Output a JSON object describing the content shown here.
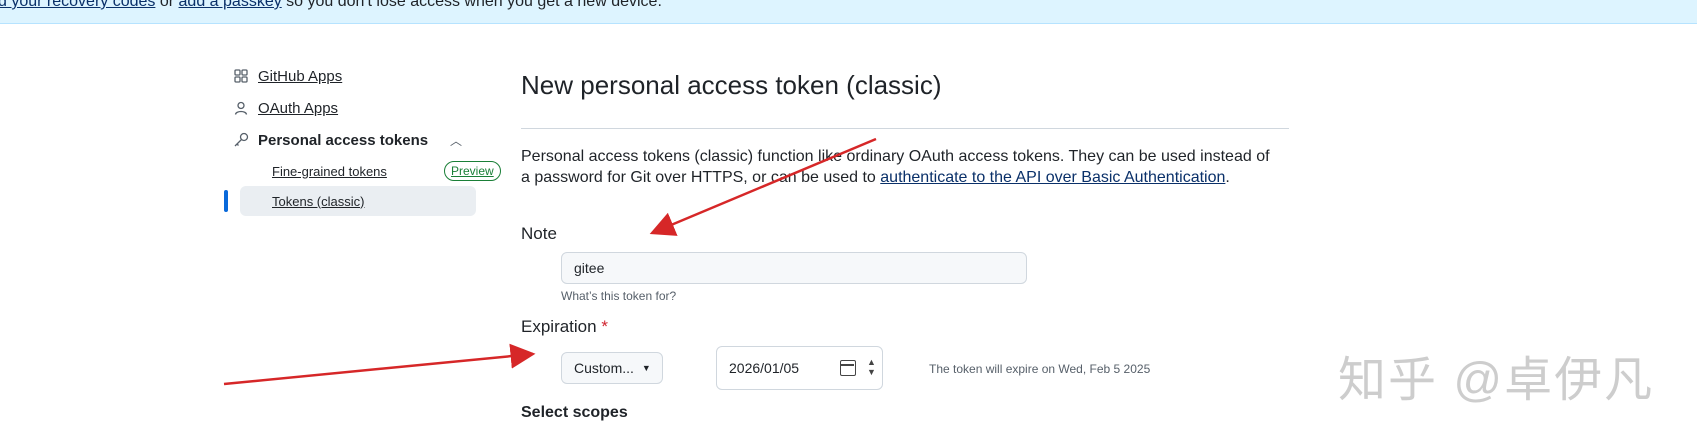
{
  "banner": {
    "link1": "d your recovery codes",
    "between": " or ",
    "link2": "add a passkey",
    "rest": " so you don't lose access when you get a new device."
  },
  "sidebar": {
    "items": [
      {
        "label": "GitHub Apps",
        "icon": "apps-icon"
      },
      {
        "label": "OAuth Apps",
        "icon": "person-icon"
      },
      {
        "label": "Personal access tokens",
        "icon": "key-icon"
      }
    ],
    "sub_items": [
      {
        "label": "Fine-grained tokens",
        "badge": "Preview"
      },
      {
        "label": "Tokens (classic)"
      }
    ]
  },
  "main": {
    "title": "New personal access token (classic)",
    "desc_text": "Personal access tokens (classic) function like ordinary OAuth access tokens. They can be used instead of a password for Git over HTTPS, or can be used to ",
    "desc_link": "authenticate to the API over Basic Authentication",
    "desc_end": ".",
    "note_label": "Note",
    "note_value": "gitee",
    "note_hint": "What’s this token for?",
    "expiration_label": "Expiration",
    "required_mark": "*",
    "expiration_select": "Custom...",
    "expiration_date": "2026/01/05",
    "expire_text": "The token will expire on Wed, Feb 5 2025",
    "scopes_title": "Select scopes"
  },
  "watermark": "知乎 @卓伊凡",
  "colors": {
    "link": "#0a3069",
    "banner_bg": "#ddf4ff",
    "active_bar": "#0969da",
    "preview_badge": "#1a7f37",
    "annotation_arrow": "#d62728"
  }
}
